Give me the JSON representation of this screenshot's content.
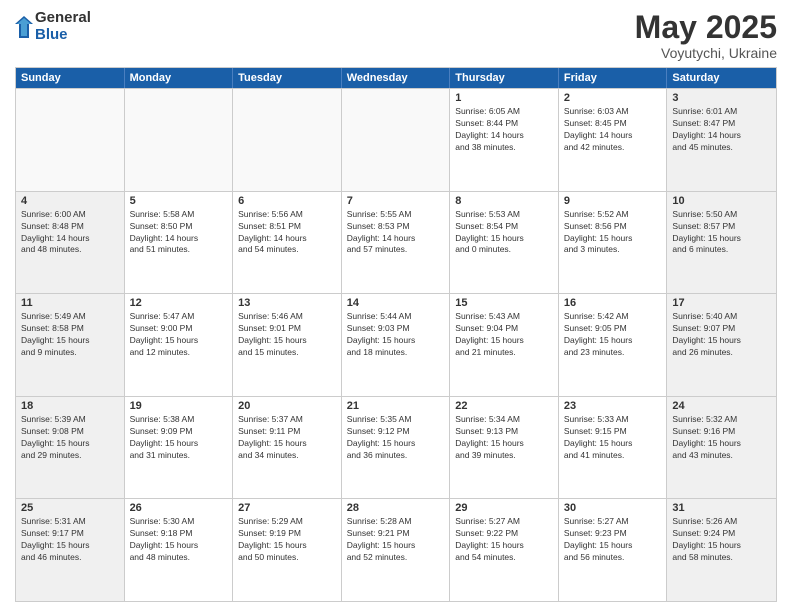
{
  "logo": {
    "general": "General",
    "blue": "Blue"
  },
  "title": "May 2025",
  "subtitle": "Voyutychi, Ukraine",
  "days": [
    "Sunday",
    "Monday",
    "Tuesday",
    "Wednesday",
    "Thursday",
    "Friday",
    "Saturday"
  ],
  "weeks": [
    [
      {
        "num": "",
        "detail": "",
        "empty": true
      },
      {
        "num": "",
        "detail": "",
        "empty": true
      },
      {
        "num": "",
        "detail": "",
        "empty": true
      },
      {
        "num": "",
        "detail": "",
        "empty": true
      },
      {
        "num": "1",
        "detail": "Sunrise: 6:05 AM\nSunset: 8:44 PM\nDaylight: 14 hours\nand 38 minutes."
      },
      {
        "num": "2",
        "detail": "Sunrise: 6:03 AM\nSunset: 8:45 PM\nDaylight: 14 hours\nand 42 minutes."
      },
      {
        "num": "3",
        "detail": "Sunrise: 6:01 AM\nSunset: 8:47 PM\nDaylight: 14 hours\nand 45 minutes."
      }
    ],
    [
      {
        "num": "4",
        "detail": "Sunrise: 6:00 AM\nSunset: 8:48 PM\nDaylight: 14 hours\nand 48 minutes."
      },
      {
        "num": "5",
        "detail": "Sunrise: 5:58 AM\nSunset: 8:50 PM\nDaylight: 14 hours\nand 51 minutes."
      },
      {
        "num": "6",
        "detail": "Sunrise: 5:56 AM\nSunset: 8:51 PM\nDaylight: 14 hours\nand 54 minutes."
      },
      {
        "num": "7",
        "detail": "Sunrise: 5:55 AM\nSunset: 8:53 PM\nDaylight: 14 hours\nand 57 minutes."
      },
      {
        "num": "8",
        "detail": "Sunrise: 5:53 AM\nSunset: 8:54 PM\nDaylight: 15 hours\nand 0 minutes."
      },
      {
        "num": "9",
        "detail": "Sunrise: 5:52 AM\nSunset: 8:56 PM\nDaylight: 15 hours\nand 3 minutes."
      },
      {
        "num": "10",
        "detail": "Sunrise: 5:50 AM\nSunset: 8:57 PM\nDaylight: 15 hours\nand 6 minutes."
      }
    ],
    [
      {
        "num": "11",
        "detail": "Sunrise: 5:49 AM\nSunset: 8:58 PM\nDaylight: 15 hours\nand 9 minutes."
      },
      {
        "num": "12",
        "detail": "Sunrise: 5:47 AM\nSunset: 9:00 PM\nDaylight: 15 hours\nand 12 minutes."
      },
      {
        "num": "13",
        "detail": "Sunrise: 5:46 AM\nSunset: 9:01 PM\nDaylight: 15 hours\nand 15 minutes."
      },
      {
        "num": "14",
        "detail": "Sunrise: 5:44 AM\nSunset: 9:03 PM\nDaylight: 15 hours\nand 18 minutes."
      },
      {
        "num": "15",
        "detail": "Sunrise: 5:43 AM\nSunset: 9:04 PM\nDaylight: 15 hours\nand 21 minutes."
      },
      {
        "num": "16",
        "detail": "Sunrise: 5:42 AM\nSunset: 9:05 PM\nDaylight: 15 hours\nand 23 minutes."
      },
      {
        "num": "17",
        "detail": "Sunrise: 5:40 AM\nSunset: 9:07 PM\nDaylight: 15 hours\nand 26 minutes."
      }
    ],
    [
      {
        "num": "18",
        "detail": "Sunrise: 5:39 AM\nSunset: 9:08 PM\nDaylight: 15 hours\nand 29 minutes."
      },
      {
        "num": "19",
        "detail": "Sunrise: 5:38 AM\nSunset: 9:09 PM\nDaylight: 15 hours\nand 31 minutes."
      },
      {
        "num": "20",
        "detail": "Sunrise: 5:37 AM\nSunset: 9:11 PM\nDaylight: 15 hours\nand 34 minutes."
      },
      {
        "num": "21",
        "detail": "Sunrise: 5:35 AM\nSunset: 9:12 PM\nDaylight: 15 hours\nand 36 minutes."
      },
      {
        "num": "22",
        "detail": "Sunrise: 5:34 AM\nSunset: 9:13 PM\nDaylight: 15 hours\nand 39 minutes."
      },
      {
        "num": "23",
        "detail": "Sunrise: 5:33 AM\nSunset: 9:15 PM\nDaylight: 15 hours\nand 41 minutes."
      },
      {
        "num": "24",
        "detail": "Sunrise: 5:32 AM\nSunset: 9:16 PM\nDaylight: 15 hours\nand 43 minutes."
      }
    ],
    [
      {
        "num": "25",
        "detail": "Sunrise: 5:31 AM\nSunset: 9:17 PM\nDaylight: 15 hours\nand 46 minutes."
      },
      {
        "num": "26",
        "detail": "Sunrise: 5:30 AM\nSunset: 9:18 PM\nDaylight: 15 hours\nand 48 minutes."
      },
      {
        "num": "27",
        "detail": "Sunrise: 5:29 AM\nSunset: 9:19 PM\nDaylight: 15 hours\nand 50 minutes."
      },
      {
        "num": "28",
        "detail": "Sunrise: 5:28 AM\nSunset: 9:21 PM\nDaylight: 15 hours\nand 52 minutes."
      },
      {
        "num": "29",
        "detail": "Sunrise: 5:27 AM\nSunset: 9:22 PM\nDaylight: 15 hours\nand 54 minutes."
      },
      {
        "num": "30",
        "detail": "Sunrise: 5:27 AM\nSunset: 9:23 PM\nDaylight: 15 hours\nand 56 minutes."
      },
      {
        "num": "31",
        "detail": "Sunrise: 5:26 AM\nSunset: 9:24 PM\nDaylight: 15 hours\nand 58 minutes."
      }
    ]
  ]
}
